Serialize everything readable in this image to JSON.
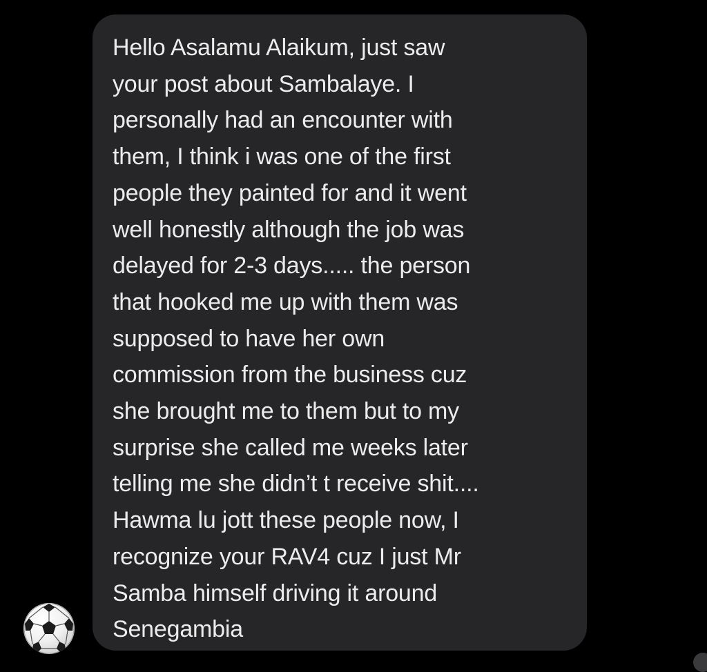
{
  "conversation": {
    "incoming_message": {
      "lines": [
        "Hello Asalamu Alaikum, just saw",
        "your post about Sambalaye. I",
        "personally had an encounter with",
        "them, I think i was one of the first",
        "people they painted for and it went",
        "well honestly although the job was",
        "delayed for 2-3 days..... the person",
        "that hooked me up with them was",
        "supposed to have her own",
        "commission from the business cuz",
        "she brought me to them but to my",
        "surprise she called me weeks later",
        "telling me she didn’t t receive shit....",
        "Hawma lu jott these people now, I",
        "recognize your RAV4 cuz I just Mr",
        "Samba himself driving it around",
        "Senegambia"
      ]
    },
    "sender_avatar": {
      "icon": "soccer-ball-icon"
    }
  },
  "colors": {
    "background": "#000000",
    "bubble": "#262628",
    "text": "#ececec"
  }
}
